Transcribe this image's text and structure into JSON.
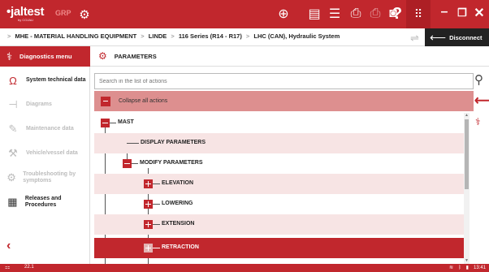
{
  "topbar": {
    "logo_text": "•jaltest",
    "logo_sub": "by COJALI",
    "module": "GRP",
    "icons": [
      "globe-icon",
      "notes-icon",
      "list-icon",
      "printer-icon",
      "disabled-printer-icon",
      "camera-icon",
      "help-icon",
      "apps-grid-icon",
      "minimize-icon",
      "restore-icon",
      "close-icon"
    ]
  },
  "breadcrumb": {
    "items": [
      "MHE - MATERIAL HANDLING EQUIPMENT",
      "LINDE",
      "116 Series (R14 - R17)",
      "LHC (CAN), Hydraulic System"
    ],
    "disconnect_label": "Disconnect"
  },
  "sidebar": {
    "header": "Diagnostics menu",
    "items": [
      {
        "label": "System technical data",
        "icon": "omega-icon",
        "enabled": true
      },
      {
        "label": "Diagrams",
        "icon": "diagram-icon",
        "enabled": false
      },
      {
        "label": "Maintenance data",
        "icon": "maintenance-icon",
        "enabled": false
      },
      {
        "label": "Vehicle/vessel data",
        "icon": "vehicle-icon",
        "enabled": false
      },
      {
        "label": "Troubleshooting by symptoms",
        "icon": "troubleshooting-icon",
        "enabled": false
      },
      {
        "label": "Releases and Procedures",
        "icon": "procedures-icon",
        "enabled": true
      }
    ]
  },
  "main": {
    "title": "PARAMETERS",
    "search_placeholder": "Search in the list of actions",
    "collapse_label": "Collapse all actions",
    "tree": [
      {
        "label": "MAST",
        "level": 0,
        "state": "expanded"
      },
      {
        "label": "DISPLAY PARAMETERS",
        "level": 1,
        "state": "leaf"
      },
      {
        "label": "MODIFY PARAMETERS",
        "level": 1,
        "state": "expanded"
      },
      {
        "label": "ELEVATION",
        "level": 2,
        "state": "collapsed"
      },
      {
        "label": "LOWERING",
        "level": 2,
        "state": "collapsed"
      },
      {
        "label": "EXTENSION",
        "level": 2,
        "state": "collapsed"
      },
      {
        "label": "RETRACTION",
        "level": 2,
        "state": "collapsed",
        "selected": true
      }
    ]
  },
  "status": {
    "version": "22.1",
    "time": "13:41"
  },
  "colors": {
    "brand_red": "#c1272d",
    "collapse_bg": "#dd8f8f",
    "row_alt": "#f7e4e4"
  }
}
